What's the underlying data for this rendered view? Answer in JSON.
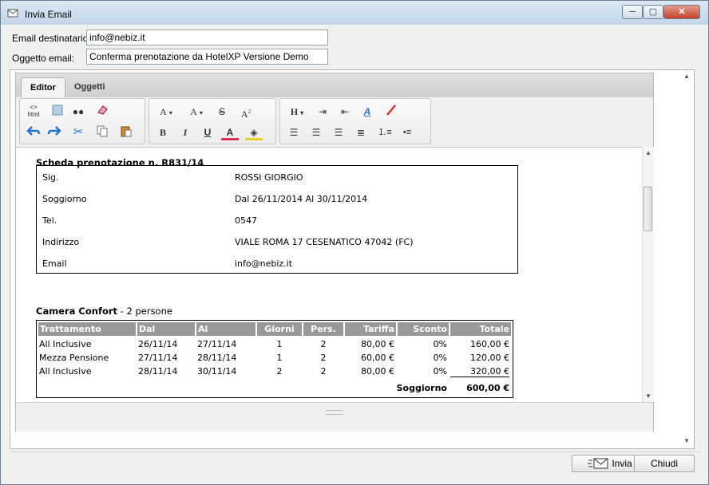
{
  "window": {
    "title": "Invia Email",
    "min_label": "─",
    "max_label": "▢",
    "close_label": "✕"
  },
  "form": {
    "to_label": "Email destinatario:",
    "to_value": "info@nebiz.it",
    "subject_label": "Oggetto email:",
    "subject_value": "Conferma prenotazione da HotelXP Versione Demo"
  },
  "tabs": [
    {
      "label": "Editor"
    },
    {
      "label": "Oggetti"
    }
  ],
  "toolbar": {
    "html_label": "html",
    "bold": "B",
    "italic": "I",
    "underline": "U",
    "font_color": "A",
    "font": "A",
    "font_size": "A",
    "strike": "S",
    "superscript": "A",
    "heading": "H"
  },
  "document": {
    "booking_title": "Scheda prenotazione n. R831/14",
    "info": [
      {
        "key": "Sig.",
        "value": "ROSSI GIORGIO"
      },
      {
        "key": "Soggiorno",
        "value": "Dal 26/11/2014 Al 30/11/2014"
      },
      {
        "key": "Tel.",
        "value": "0547"
      },
      {
        "key": "Indirizzo",
        "value": "VIALE ROMA 17 CESENATICO 47042 (FC)"
      },
      {
        "key": "Email",
        "value": "info@nebiz.it"
      }
    ],
    "room_name": "Camera Confort",
    "room_persons": " - 2 persone",
    "table_headers": [
      "Trattamento",
      "Dal",
      "Al",
      "Giorni",
      "Pers.",
      "Tariffa",
      "Sconto",
      "Totale"
    ],
    "rows": [
      [
        "All Inclusive",
        "26/11/14",
        "27/11/14",
        "1",
        "2",
        "80,00 €",
        "0%",
        "160,00 €"
      ],
      [
        "Mezza Pensione",
        "27/11/14",
        "28/11/14",
        "1",
        "2",
        "60,00 €",
        "0%",
        "120,00 €"
      ],
      [
        "All Inclusive",
        "28/11/14",
        "30/11/14",
        "2",
        "2",
        "80,00 €",
        "0%",
        "320,00 €"
      ]
    ],
    "total_label": "Soggiorno",
    "total_value": "600,00 €"
  },
  "buttons": {
    "send_label": "Invia",
    "close_label": "Chiudi"
  }
}
